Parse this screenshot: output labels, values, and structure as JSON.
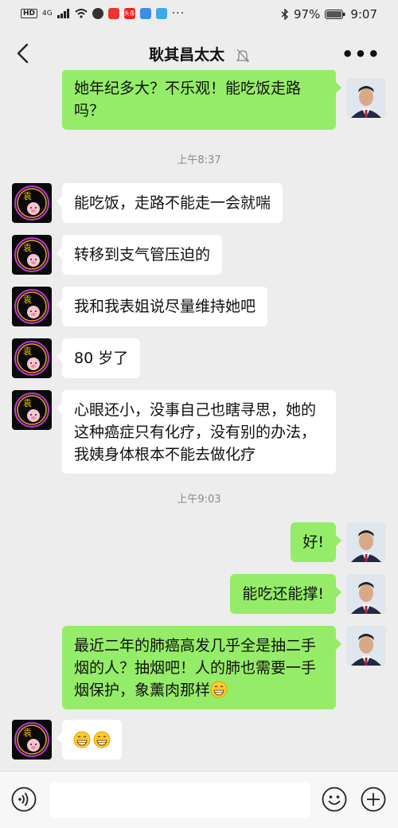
{
  "status": {
    "network": "4G",
    "battery": "97%",
    "time": "9:07",
    "badge": "头条"
  },
  "nav": {
    "title": "耿其昌太太",
    "more": "•••"
  },
  "messages": {
    "m0": "她年纪多大？不乐观！能吃饭走路吗？",
    "t1": "上午8:37",
    "m1": "能吃饭，走路不能走一会就喘",
    "m2": "转移到支气管压迫的",
    "m3": "我和我表姐说尽量维持她吧",
    "m4": "80 岁了",
    "m5": "心眼还小，没事自己也瞎寻思，她的这种癌症只有化疗，没有别的办法，我姨身体根本不能去做化疗",
    "t2": "上午9:03",
    "m6": "好!",
    "m7": "能吃还能撑!",
    "m8": "最近二年的肺癌高发几乎全是抽二手烟的人？抽烟吧！人的肺也需要一手烟保护，象薰肉那样"
  },
  "colors": {
    "sent_bubble": "#95ec69",
    "received_bubble": "#ffffff",
    "background": "#ededed"
  },
  "icons": [
    "back-arrow-icon",
    "mute-bell-icon",
    "more-icon",
    "voice-icon",
    "emoji-icon",
    "add-icon",
    "grin-emoji-icon"
  ]
}
